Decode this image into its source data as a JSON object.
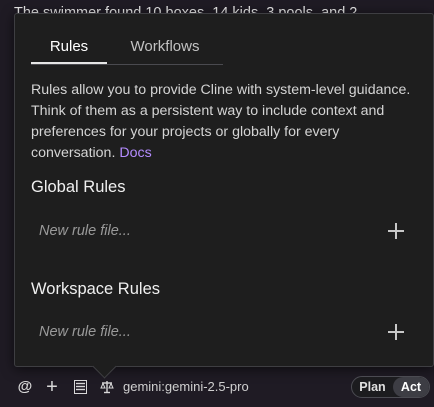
{
  "background": {
    "chat_text": "The swimmer found 10 boxes, 14 kids, 3 pools, and 2"
  },
  "tabs": [
    {
      "label": "Rules",
      "active": true
    },
    {
      "label": "Workflows",
      "active": false
    }
  ],
  "description": {
    "text": "Rules allow you to provide Cline with system-level guidance. Think of them as a persistent way to include context and preferences for your projects or globally for every conversation.",
    "link_label": "Docs"
  },
  "global_rules": {
    "title": "Global Rules",
    "placeholder": "New rule file..."
  },
  "workspace_rules": {
    "title": "Workspace Rules",
    "placeholder": "New rule file..."
  },
  "bottom_bar": {
    "at_icon": "@",
    "add_icon": "+",
    "model": "gemini:gemini-2.5-pro",
    "plan_label": "Plan",
    "act_label": "Act",
    "active_mode": "Act"
  },
  "colors": {
    "accent_link": "#b48cff",
    "panel_bg": "#1e1e1e",
    "page_bg": "#1f1b24"
  }
}
